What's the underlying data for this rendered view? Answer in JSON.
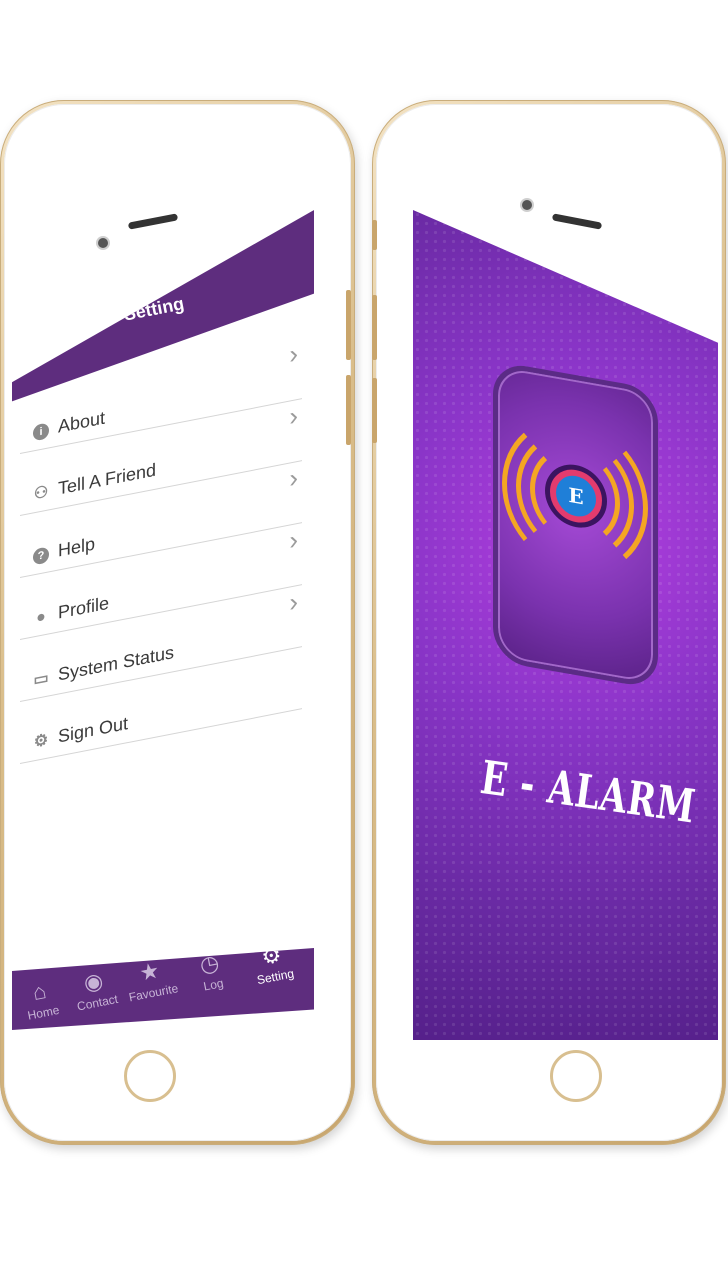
{
  "settings_screen": {
    "header": {
      "title": "Setting"
    },
    "menu": [
      {
        "label": "About",
        "icon": "info-icon"
      },
      {
        "label": "Tell A Friend",
        "icon": "share-user-icon"
      },
      {
        "label": "Help",
        "icon": "help-icon"
      },
      {
        "label": "Profile",
        "icon": "profile-icon"
      },
      {
        "label": "System Status",
        "icon": "monitor-icon"
      },
      {
        "label": "Sign Out",
        "icon": "gears-icon"
      }
    ],
    "tab_bar": {
      "active": "Setting",
      "tabs": [
        {
          "label": "Home",
          "icon": "home-icon"
        },
        {
          "label": "Contact",
          "icon": "contact-icon"
        },
        {
          "label": "Favourite",
          "icon": "star-icon"
        },
        {
          "label": "Log",
          "icon": "clock-icon"
        },
        {
          "label": "Setting",
          "icon": "gear-icon"
        }
      ]
    }
  },
  "splash_screen": {
    "app_icon_letter": "E",
    "brand_title": "E - ALARM"
  },
  "colors": {
    "primary_purple": "#5e2d7e",
    "splash_purple": "#8a35c8",
    "wave_orange": "#f4a623",
    "core_blue": "#1f7fd8",
    "phone_gold": "#d9bd8a"
  }
}
